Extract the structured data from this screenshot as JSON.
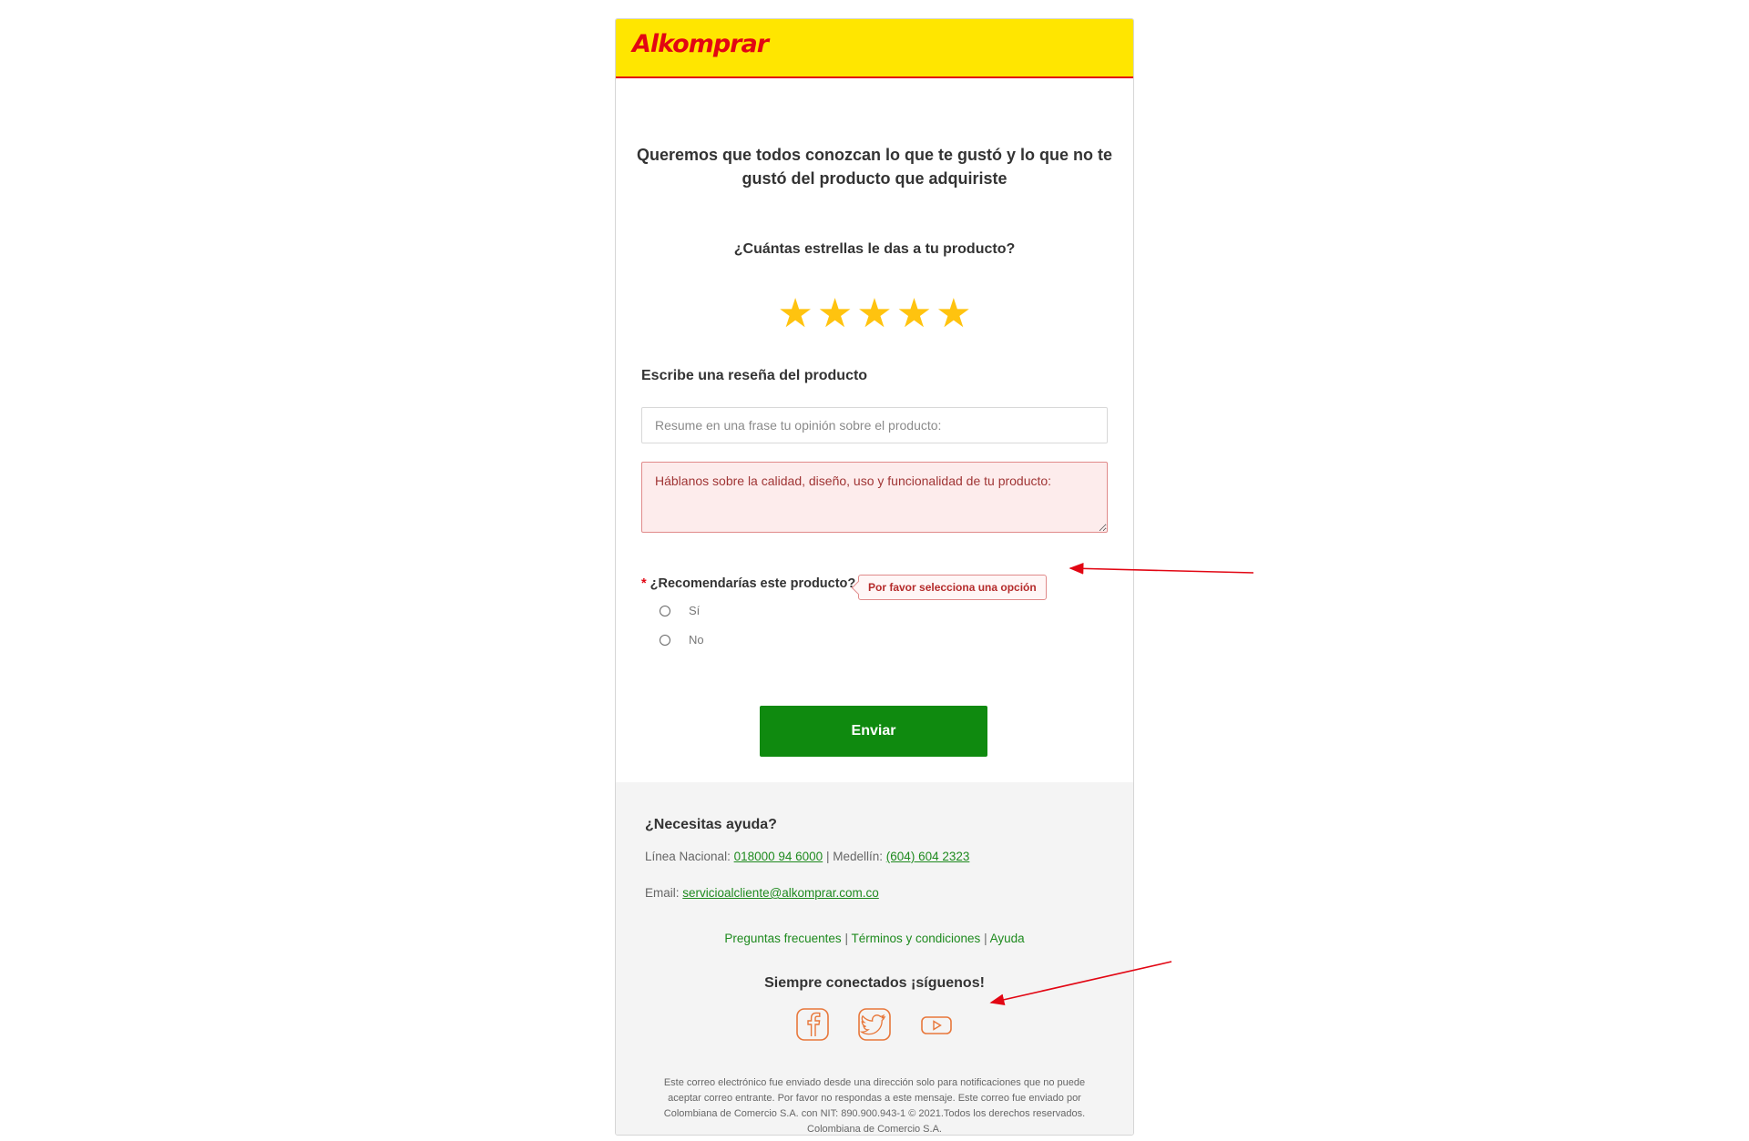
{
  "brand": {
    "logo_text": "Alkomprar",
    "header_color": "#ffe600",
    "logo_color": "#e20613"
  },
  "form": {
    "headline": "Queremos que todos conozcan lo que te gustó y lo que no te gustó del producto que adquiriste",
    "stars_question": "¿Cuántas estrellas le das a tu producto?",
    "rating": 5,
    "max_stars": 5,
    "review_label": "Escribe una reseña del producto",
    "summary_placeholder": "Resume en una frase tu opinión sobre el producto:",
    "detail_placeholder": "Háblanos sobre la calidad, diseño, uso y funcionalidad de tu producto:",
    "recommend_required_mark": "*",
    "recommend_question": "¿Recomendarías este producto?",
    "validation_tooltip": "Por favor selecciona una opción",
    "options": [
      {
        "label": "Sí"
      },
      {
        "label": "No"
      }
    ],
    "submit_label": "Enviar"
  },
  "footer": {
    "help_title": "¿Necesitas ayuda?",
    "national_label": "Línea Nacional:",
    "national_phone": "018000 94 6000",
    "separator": "|",
    "medellin_label": "Medellín:",
    "medellin_phone": "(604) 604 2323",
    "email_label": "Email:",
    "email": "servicioalcliente@alkomprar.com.co",
    "links": [
      "Preguntas frecuentes",
      "Términos y condiciones",
      "Ayuda"
    ],
    "follow_title": "Siempre conectados ¡síguenos!",
    "socials": [
      "facebook-icon",
      "twitter-icon",
      "youtube-icon"
    ],
    "disclaimer": "Este correo electrónico fue enviado desde una dirección solo para notificaciones que no puede aceptar correo entrante. Por favor no respondas a este mensaje. Este correo fue enviado por Colombiana de Comercio S.A. con NIT: 890.900.943-1 © 2021.Todos los derechos reservados. Colombiana de Comercio S.A."
  },
  "colors": {
    "accent_green": "#0f8a0f",
    "star": "#ffc30f",
    "error": "#e20613",
    "social_orange": "#e8773a"
  }
}
